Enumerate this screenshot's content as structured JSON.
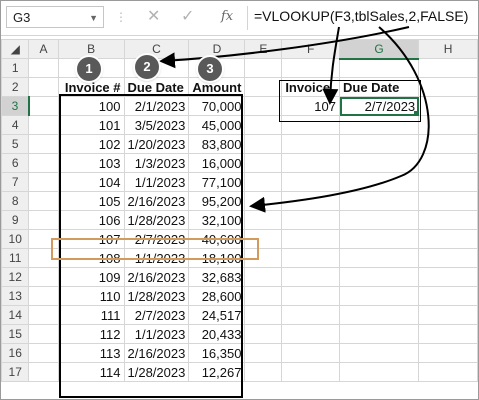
{
  "name_box": "G3",
  "fx_label": "fx",
  "formula": "=VLOOKUP(F3,tblSales,2,FALSE)",
  "column_headers": [
    "A",
    "B",
    "C",
    "D",
    "E",
    "F",
    "G",
    "H"
  ],
  "row_headers": [
    "1",
    "2",
    "3",
    "4",
    "5",
    "6",
    "7",
    "8",
    "9",
    "10",
    "11",
    "12",
    "13",
    "14",
    "15",
    "16",
    "17"
  ],
  "table": {
    "headers": [
      "Invoice #",
      "Due Date",
      "Amount"
    ],
    "rows": [
      [
        "100",
        "2/1/2023",
        "70,000"
      ],
      [
        "101",
        "3/5/2023",
        "45,000"
      ],
      [
        "102",
        "1/20/2023",
        "83,800"
      ],
      [
        "103",
        "1/3/2023",
        "16,000"
      ],
      [
        "104",
        "1/1/2023",
        "77,100"
      ],
      [
        "105",
        "2/16/2023",
        "95,200"
      ],
      [
        "106",
        "1/28/2023",
        "32,100"
      ],
      [
        "107",
        "2/7/2023",
        "40,600"
      ],
      [
        "108",
        "1/1/2023",
        "18,100"
      ],
      [
        "109",
        "2/16/2023",
        "32,683"
      ],
      [
        "110",
        "1/28/2023",
        "28,600"
      ],
      [
        "111",
        "2/7/2023",
        "24,517"
      ],
      [
        "112",
        "1/1/2023",
        "20,433"
      ],
      [
        "113",
        "2/16/2023",
        "16,350"
      ],
      [
        "114",
        "1/28/2023",
        "12,267"
      ]
    ]
  },
  "lookup": {
    "headers": [
      "Invoice",
      "Due Date"
    ],
    "invoice": "107",
    "due_date": "2/7/2023"
  },
  "badges": [
    "1",
    "2",
    "3"
  ],
  "colors": {
    "selection": "#217346",
    "highlight": "#d29a5c",
    "badge": "#595959"
  }
}
